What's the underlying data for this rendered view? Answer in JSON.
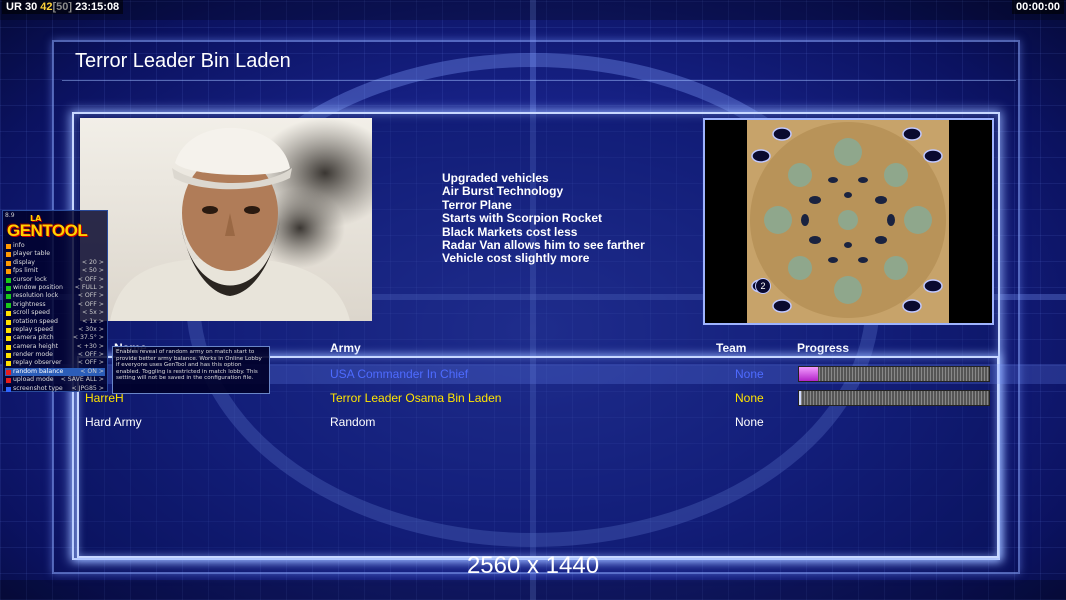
{
  "status": {
    "left": {
      "ur": "UR",
      "a": "30",
      "b": "42",
      "c": "[50]",
      "time": "23:15:08"
    },
    "right_time": "00:00:00"
  },
  "title": "Terror Leader Bin Laden",
  "features": [
    "Upgraded vehicles",
    "Air Burst Technology",
    "Terror Plane",
    "Starts with Scorpion Rocket",
    "Black Markets cost less",
    "Radar Van allows him to see farther",
    "Vehicle cost slightly more"
  ],
  "map_slot_number": "2",
  "table": {
    "headers": {
      "name": "Name",
      "army": "Army",
      "team": "Team",
      "progress": "Progress"
    },
    "rows": [
      {
        "name": "",
        "army": "USA Commander In Chief",
        "team": "None",
        "progress": 0.1,
        "color": "#4e6bff"
      },
      {
        "name": "HarreH",
        "army": "Terror Leader Osama Bin Laden",
        "team": "None",
        "progress": 0.01,
        "color": "#ffe400"
      },
      {
        "name": "Hard Army",
        "army": "Random",
        "team": "None",
        "progress": null,
        "color": "#ffffff"
      }
    ]
  },
  "resolution": "2560 x 1440",
  "gentool": {
    "version": "8.9",
    "logo_la": "LA",
    "logo": "GENTOOL",
    "items": [
      {
        "label": "info",
        "value": "",
        "color": "#ff9900"
      },
      {
        "label": "player table",
        "value": "",
        "color": "#ff9900"
      },
      {
        "label": "display",
        "value": "< 20 >",
        "color": "#ff9900"
      },
      {
        "label": "fps limit",
        "value": "< 50 >",
        "color": "#ff9900"
      },
      {
        "label": "cursor lock",
        "value": "< OFF >",
        "color": "#19c819"
      },
      {
        "label": "window position",
        "value": "< FULL >",
        "color": "#19c819"
      },
      {
        "label": "resolution lock",
        "value": "< OFF >",
        "color": "#19c819"
      },
      {
        "label": "brightness",
        "value": "< OFF >",
        "color": "#19c819"
      },
      {
        "label": "scroll speed",
        "value": "< 5x >",
        "color": "#ffe100"
      },
      {
        "label": "rotation speed",
        "value": "< 1x >",
        "color": "#ffe100"
      },
      {
        "label": "replay speed",
        "value": "< 30x >",
        "color": "#ffe100"
      },
      {
        "label": "camera pitch",
        "value": "< 37.5° >",
        "color": "#ffe100"
      },
      {
        "label": "camera height",
        "value": "< +30 >",
        "color": "#ffe100"
      },
      {
        "label": "render mode",
        "value": "< OFF >",
        "color": "#ffe100"
      },
      {
        "label": "replay observer",
        "value": "< OFF >",
        "color": "#ffe100"
      },
      {
        "label": "random balance",
        "value": "< ON >",
        "color": "#e51d1d"
      },
      {
        "label": "upload mode",
        "value": "< SAVE ALL >",
        "color": "#e51d1d"
      },
      {
        "label": "screenshot type",
        "value": "< JPG85 >",
        "color": "#2d64ff"
      }
    ],
    "selected_index": 15,
    "tooltip": "Enables reveal of random army on match start to provide better army balance. Works in Online Lobby if everyone uses GenTool and has this option enabled. Toggling is restricted in match lobby. This setting will not be saved in the configuration file."
  }
}
